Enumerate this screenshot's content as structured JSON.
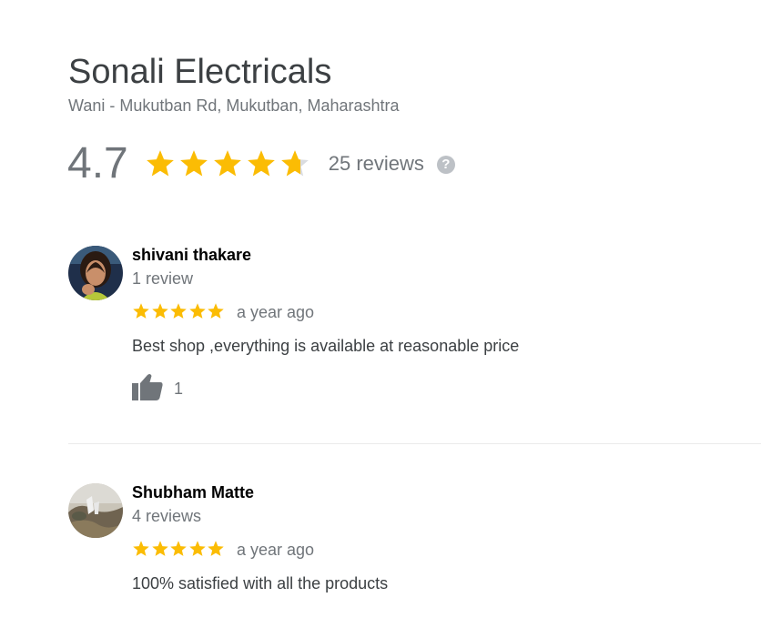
{
  "business": {
    "name": "Sonali Electricals",
    "address": "Wani - Mukutban Rd, Mukutban, Maharashtra",
    "rating": "4.7",
    "rating_value": 4.7,
    "reviews_count": "25 reviews",
    "help_glyph": "?"
  },
  "colors": {
    "star": "#fbbc04",
    "star_empty": "#dadce0",
    "muted": "#70757a"
  },
  "reviews": [
    {
      "name": "shivani thakare",
      "meta": "1 review",
      "stars": 5,
      "time": "a year ago",
      "text": "Best shop ,everything is available at reasonable price",
      "likes": "1"
    },
    {
      "name": "Shubham Matte",
      "meta": "4 reviews",
      "stars": 5,
      "time": "a year ago",
      "text": "100% satisfied with all the products"
    }
  ]
}
